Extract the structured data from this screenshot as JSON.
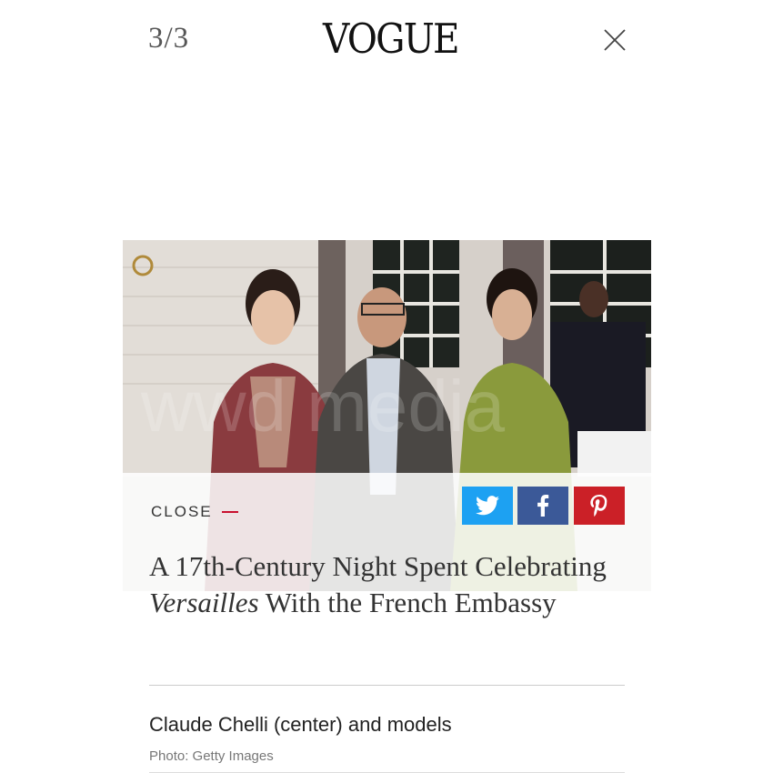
{
  "header": {
    "counter": "3/3",
    "logo": "VOGUE"
  },
  "gallery": {
    "close_label": "CLOSE",
    "share_buttons": [
      {
        "name": "twitter",
        "color": "#1da1f2",
        "icon": "twitter-bird-icon"
      },
      {
        "name": "facebook",
        "color": "#3b5998",
        "icon": "facebook-f-icon"
      },
      {
        "name": "pinterest",
        "color": "#cb2027",
        "icon": "pinterest-p-icon"
      }
    ],
    "title_part1": "A 17th-Century Night Spent Celebrating ",
    "title_italic": "Versailles",
    "title_part2": " With the French Embassy",
    "caption": "Claude Chelli (center) and models",
    "credit": "Photo: Getty Images"
  },
  "colors": {
    "accent": "#c8102e",
    "text": "#333333"
  }
}
